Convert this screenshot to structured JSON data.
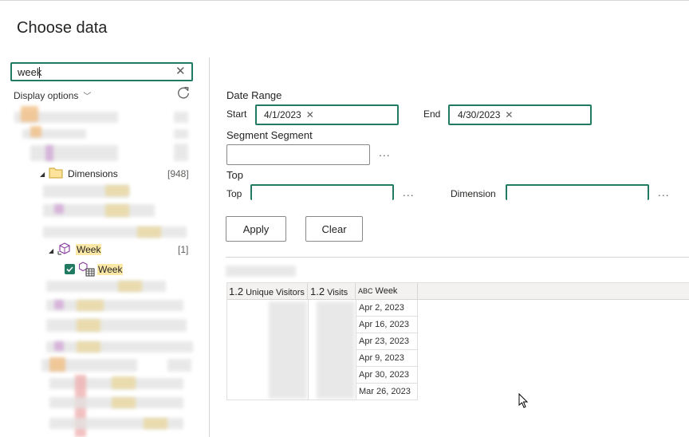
{
  "dialog": {
    "title": "Choose data"
  },
  "navigator": {
    "search_value": "week",
    "display_options_label": "Display options",
    "dimensions": {
      "label": "Dimensions",
      "count": "[948]"
    },
    "week_group": {
      "label": "Week",
      "count": "[1]"
    },
    "week_item": {
      "label": "Week",
      "checked": true
    }
  },
  "filters": {
    "date_range_label": "Date Range",
    "start_label": "Start",
    "start_value": "4/1/2023",
    "end_label": "End",
    "end_value": "4/30/2023",
    "segment_label": "Segment Segment",
    "segment_value": "",
    "top_section_label": "Top",
    "top_label": "Top",
    "top_value": "",
    "dimension_label": "Dimension",
    "dimension_value": "",
    "more_label": "..."
  },
  "buttons": {
    "apply": "Apply",
    "clear": "Clear"
  },
  "preview": {
    "type_icons": {
      "number": "1.2",
      "text": "ABC"
    },
    "columns": [
      "Unique Visitors",
      "Visits",
      "Week"
    ],
    "rows": [
      {
        "week": "Apr 2, 2023"
      },
      {
        "week": "Apr 16, 2023"
      },
      {
        "week": "Apr 23, 2023"
      },
      {
        "week": "Apr 9, 2023"
      },
      {
        "week": "Apr 30, 2023"
      },
      {
        "week": "Mar 26, 2023"
      }
    ]
  },
  "colors": {
    "accent": "#217a62",
    "highlight": "#fbe7a6"
  }
}
